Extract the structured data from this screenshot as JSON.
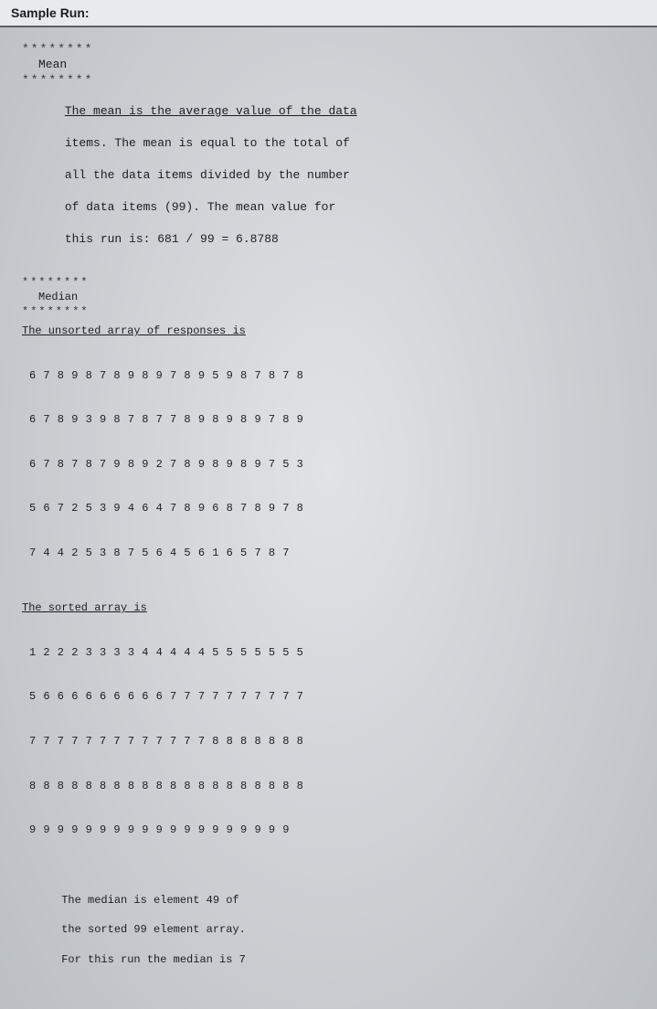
{
  "header_title": "Sample Run:",
  "separator": "********",
  "mean": {
    "title": "Mean",
    "para_lines": [
      "The mean is the average value of the data",
      "items. The mean is equal to the total of",
      "all the data items divided by the number",
      "of data items (99). The mean value for",
      "this run is: 681 / 99 = 6.8788"
    ]
  },
  "median": {
    "title": "Median",
    "unsorted_label": "The unsorted array of responses is",
    "unsorted_rows": [
      "6 7 8 9 8 7 8 9 8 9 7 8 9 5 9 8 7 8 7 8",
      "6 7 8 9 3 9 8 7 8 7 7 8 9 8 9 8 9 7 8 9",
      "6 7 8 7 8 7 9 8 9 2 7 8 9 8 9 8 9 7 5 3",
      "5 6 7 2 5 3 9 4 6 4 7 8 9 6 8 7 8 9 7 8",
      "7 4 4 2 5 3 8 7 5 6 4 5 6 1 6 5 7 8 7"
    ],
    "sorted_label": "The sorted array is",
    "sorted_rows": [
      "1 2 2 2 3 3 3 3 4 4 4 4 4 5 5 5 5 5 5 5",
      "5 6 6 6 6 6 6 6 6 6 7 7 7 7 7 7 7 7 7 7",
      "7 7 7 7 7 7 7 7 7 7 7 7 7 8 8 8 8 8 8 8",
      "8 8 8 8 8 8 8 8 8 8 8 8 8 8 8 8 8 8 8 8",
      "9 9 9 9 9 9 9 9 9 9 9 9 9 9 9 9 9 9 9"
    ],
    "conclusion_lines": [
      "The median is element 49 of",
      "the sorted 99 element array.",
      "For this run the median is 7"
    ]
  }
}
